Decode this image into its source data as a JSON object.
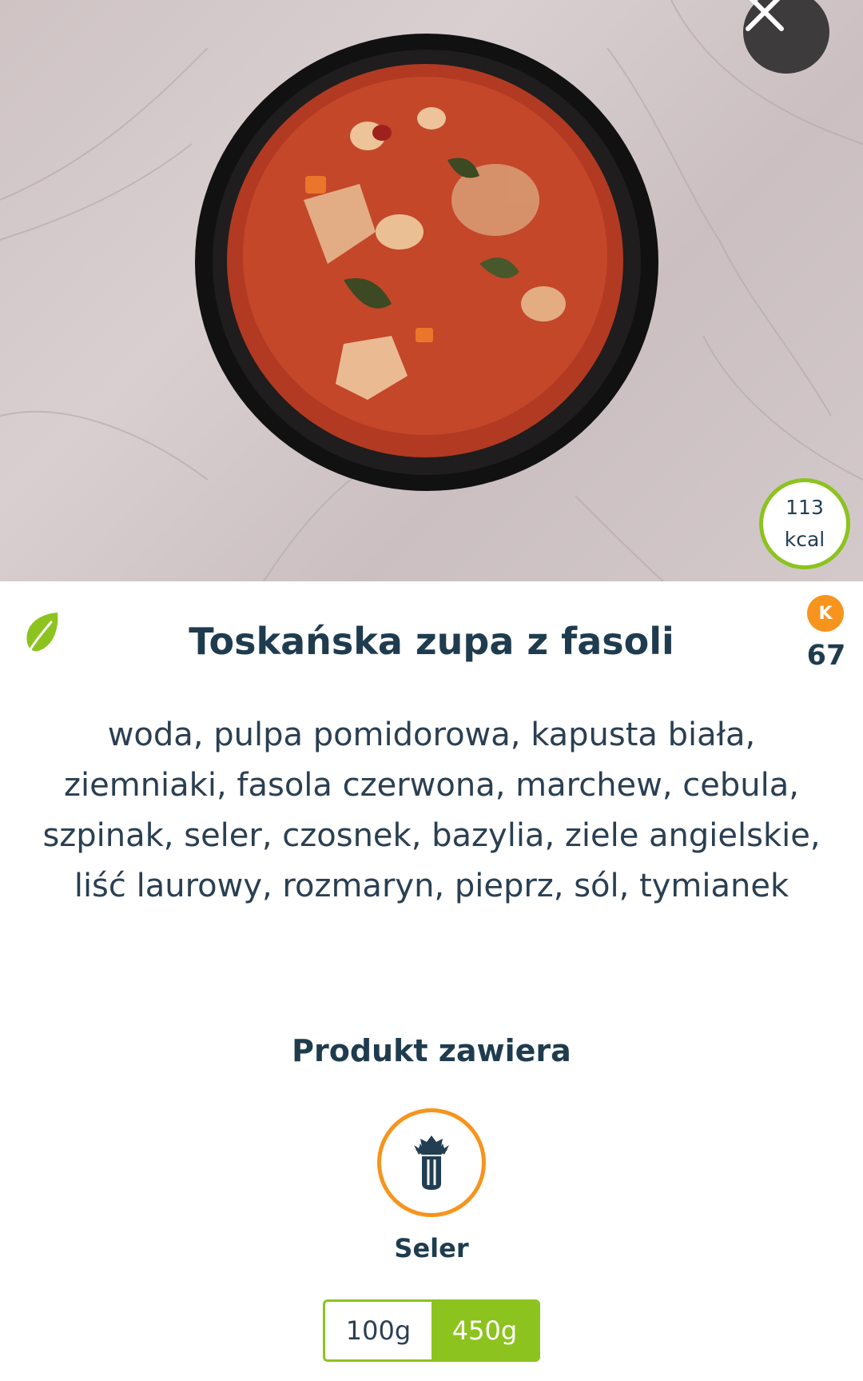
{
  "product": {
    "title": "Toskańska zupa z fasoli",
    "kcal_value": "113",
    "kcal_unit": "kcal",
    "score_badge": "K",
    "score_value": "67",
    "ingredients": "woda, pulpa pomidorowa, kapusta biała, ziemniaki, fasola czerwona, marchew, cebula, szpinak, seler, czosnek, bazylia, ziele angielskie, liść laurowy, rozmaryn, pieprz, sól, tymianek"
  },
  "allergens": {
    "title": "Produkt zawiera",
    "items": [
      {
        "label": "Seler",
        "icon": "celery-icon"
      }
    ]
  },
  "sizes": {
    "options": [
      "100g",
      "450g"
    ],
    "selected": "450g"
  },
  "icons": {
    "close": "close-icon",
    "diet": "leaf-icon"
  },
  "colors": {
    "accent_green": "#8cc31f",
    "accent_orange": "#f7941d",
    "text_dark": "#1f3c4f"
  }
}
